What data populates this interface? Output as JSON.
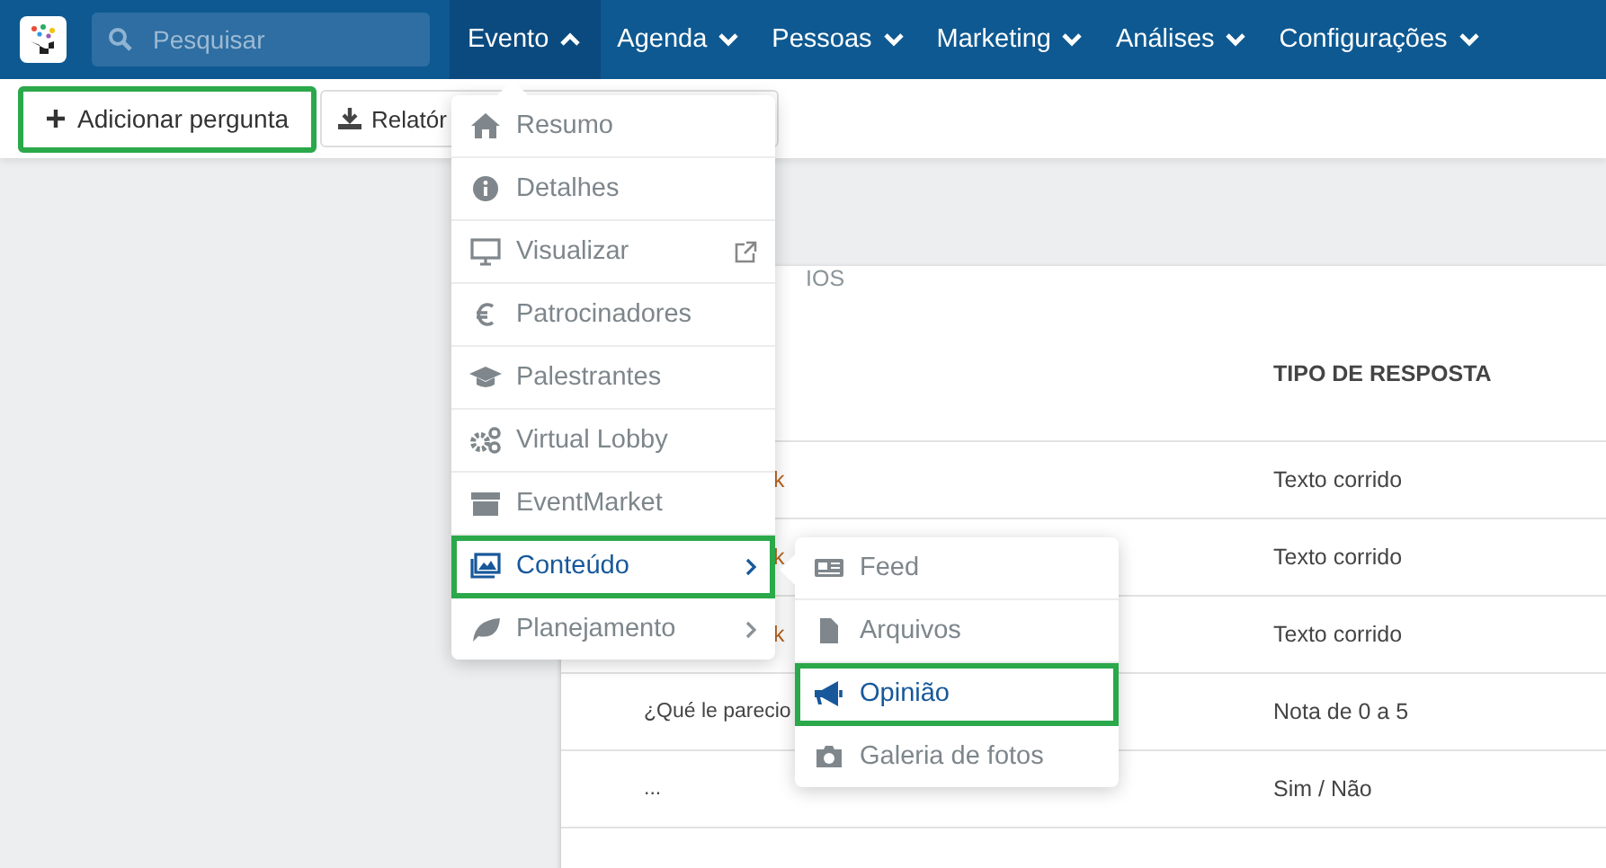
{
  "topbar": {
    "search": {
      "placeholder": "Pesquisar"
    },
    "nav": [
      {
        "label": "Evento",
        "selected": true
      },
      {
        "label": "Agenda",
        "selected": false
      },
      {
        "label": "Pessoas",
        "selected": false
      },
      {
        "label": "Marketing",
        "selected": false
      },
      {
        "label": "Análises",
        "selected": false
      },
      {
        "label": "Configurações",
        "selected": false
      }
    ]
  },
  "toolbar": {
    "buttons": [
      {
        "label": "Adicionar pergunta",
        "highlighted": true
      },
      {
        "label": "Relatór",
        "highlighted": false
      }
    ]
  },
  "card": {
    "title": "IOS",
    "table": {
      "columns": [
        "TIPO DE RESPOSTA"
      ],
      "rows": [
        {
          "kind": "fragment",
          "column_1": "k",
          "column_2": "Texto corrido"
        },
        {
          "kind": "fragment",
          "column_1": "k",
          "column_2": "Texto corrido"
        },
        {
          "kind": "fragment",
          "column_1": "k",
          "column_2": "Texto corrido"
        },
        {
          "kind": "text",
          "column_1": "¿Qué le parecio",
          "column_2": "Nota de 0 a 5"
        },
        {
          "kind": "text",
          "column_1": "...",
          "column_2": "Sim / Não"
        }
      ]
    }
  },
  "event_menu": {
    "items": [
      {
        "label": "Resumo",
        "selected": false,
        "highlighted": false
      },
      {
        "label": "Detalhes",
        "selected": false,
        "highlighted": false
      },
      {
        "label": "Visualizar",
        "selected": false,
        "highlighted": false,
        "kind": "external"
      },
      {
        "label": "Patrocinadores",
        "selected": false,
        "highlighted": false
      },
      {
        "label": "Palestrantes",
        "selected": false,
        "highlighted": false
      },
      {
        "label": "Virtual Lobby",
        "selected": false,
        "highlighted": false
      },
      {
        "label": "EventMarket",
        "selected": false,
        "highlighted": false
      },
      {
        "label": "Conteúdo",
        "selected": true,
        "highlighted": true,
        "kind": "submenu"
      },
      {
        "label": "Planejamento",
        "selected": false,
        "highlighted": false,
        "kind": "submenu"
      }
    ]
  },
  "content_submenu": {
    "items": [
      {
        "label": "Feed",
        "selected": false,
        "highlighted": false
      },
      {
        "label": "Arquivos",
        "selected": false,
        "highlighted": false
      },
      {
        "label": "Opinião",
        "selected": true,
        "highlighted": true
      },
      {
        "label": "Galeria de fotos",
        "selected": false,
        "highlighted": false
      }
    ]
  }
}
